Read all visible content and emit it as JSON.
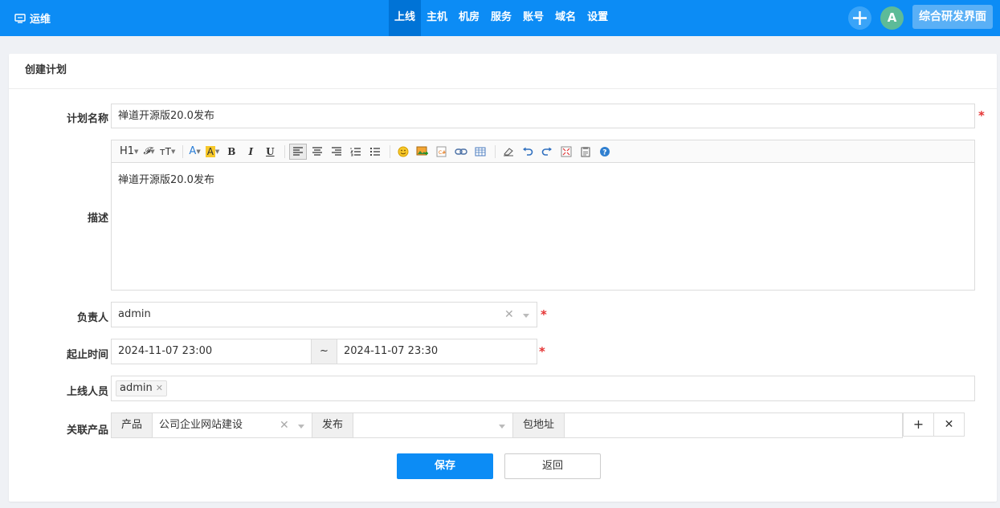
{
  "header": {
    "app_name": "运维",
    "nav": [
      {
        "label": "上线",
        "active": true
      },
      {
        "label": "主机",
        "active": false
      },
      {
        "label": "机房",
        "active": false
      },
      {
        "label": "服务",
        "active": false
      },
      {
        "label": "账号",
        "active": false
      },
      {
        "label": "域名",
        "active": false
      },
      {
        "label": "设置",
        "active": false
      }
    ],
    "avatar_letter": "A",
    "switch_label": "综合研发界面"
  },
  "panel": {
    "title": "创建计划"
  },
  "form": {
    "name_label": "计划名称",
    "name_value": "禅道开源版20.0发布",
    "desc_label": "描述",
    "desc_value": "禅道开源版20.0发布",
    "owner_label": "负责人",
    "owner_value": "admin",
    "time_label": "起止时间",
    "start_time": "2024-11-07 23:00",
    "time_sep": "~",
    "end_time": "2024-11-07 23:30",
    "members_label": "上线人员",
    "members": [
      "admin"
    ],
    "product_label": "关联产品",
    "product_addon": "产品",
    "product_value": "公司企业网站建设",
    "release_addon": "发布",
    "release_value": "",
    "package_addon": "包地址",
    "package_value": "",
    "required_mark": "*"
  },
  "toolbar": {
    "heading": "H1",
    "font": "𝓕",
    "size": "тT",
    "font_color": "A",
    "bg_color": "A",
    "bold": "B",
    "italic": "I",
    "underline": "U"
  },
  "actions": {
    "save": "保存",
    "back": "返回",
    "add_symbol": "+",
    "remove_symbol": "✕"
  },
  "colors": {
    "primary": "#0c8cf5",
    "nav_active": "#0073d6",
    "required": "#e53333"
  }
}
